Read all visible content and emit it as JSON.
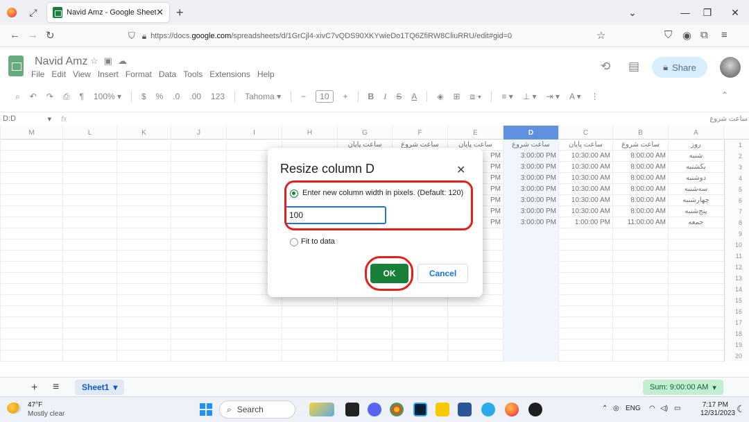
{
  "browser": {
    "tab_title": "Navid Amz - Google Sheets",
    "url_prefix": "https://docs.",
    "url_domain": "google.com",
    "url_path": "/spreadsheets/d/1GrCjl4-xivC7vQDS90XKYwieDo1TQ6ZfiRW8CliuRRU/edit#gid=0"
  },
  "sheets": {
    "doc_title": "Navid Amz",
    "menu": [
      "File",
      "Edit",
      "View",
      "Insert",
      "Format",
      "Data",
      "Tools",
      "Extensions",
      "Help"
    ],
    "share_label": "Share",
    "toolbar": {
      "zoom": "100%",
      "currency": "$",
      "percent": "%",
      "dec_less": ".0",
      "dec_more": ".00",
      "format_123": "123",
      "font": "Tahoma",
      "font_size": "10"
    },
    "namebox": "D:D",
    "fx": "fx",
    "formula_text": "ساعت شروع"
  },
  "grid": {
    "columns": [
      "M",
      "L",
      "K",
      "J",
      "I",
      "H",
      "G",
      "F",
      "E",
      "D",
      "C",
      "B",
      "A"
    ],
    "selected_column": "D",
    "header_row": {
      "G": "ساعت پایان",
      "F": "ساعت شروع",
      "E": "ساعت پایان",
      "D": "ساعت شروع",
      "C": "ساعت پایان",
      "B": "ساعت شروع",
      "A": "روز"
    },
    "rows": [
      {
        "E": "PM",
        "D": "3:00:00 PM",
        "C": "10:30:00 AM",
        "B": "8:00:00 AM",
        "A": "شنبه"
      },
      {
        "E": "PM",
        "D": "3:00:00 PM",
        "C": "10:30:00 AM",
        "B": "8:00:00 AM",
        "A": "یکشنبه"
      },
      {
        "E": "PM",
        "D": "3:00:00 PM",
        "C": "10:30:00 AM",
        "B": "8:00:00 AM",
        "A": "دوشنبه"
      },
      {
        "E": "PM",
        "D": "3:00:00 PM",
        "C": "10:30:00 AM",
        "B": "8:00:00 AM",
        "A": "سه‌شنبه"
      },
      {
        "E": "PM",
        "D": "3:00:00 PM",
        "C": "10:30:00 AM",
        "B": "8:00:00 AM",
        "A": "چهارشنبه"
      },
      {
        "E": "PM",
        "D": "3:00:00 PM",
        "C": "10:30:00 AM",
        "B": "8:00:00 AM",
        "A": "پنج‌شنبه"
      },
      {
        "E": "PM",
        "D": "3:00:00 PM",
        "C": "1:00:00 PM",
        "B": "11:00:00 AM",
        "A": "جمعه"
      }
    ],
    "row_numbers": [
      "1",
      "2",
      "3",
      "4",
      "5",
      "6",
      "7",
      "8",
      "9",
      "10",
      "11",
      "12",
      "13",
      "14",
      "15",
      "16",
      "17",
      "18",
      "19",
      "20"
    ]
  },
  "dialog": {
    "title": "Resize column D",
    "option_width": "Enter new column width in pixels. (Default: 120)",
    "width_value": "100",
    "option_fit": "Fit to data",
    "ok": "OK",
    "cancel": "Cancel"
  },
  "sheetbar": {
    "sheet_name": "Sheet1",
    "sum": "Sum: 9:00:00 AM"
  },
  "taskbar": {
    "temperature": "47°F",
    "weather": "Mostly clear",
    "search": "Search",
    "lang": "ENG",
    "time": "7:17 PM",
    "date": "12/31/2023"
  },
  "colors": {
    "sheets_green": "#188038",
    "selected_col": "#0b57d0",
    "highlight_red": "#e0201b",
    "share_bg": "#c2e7ff"
  }
}
